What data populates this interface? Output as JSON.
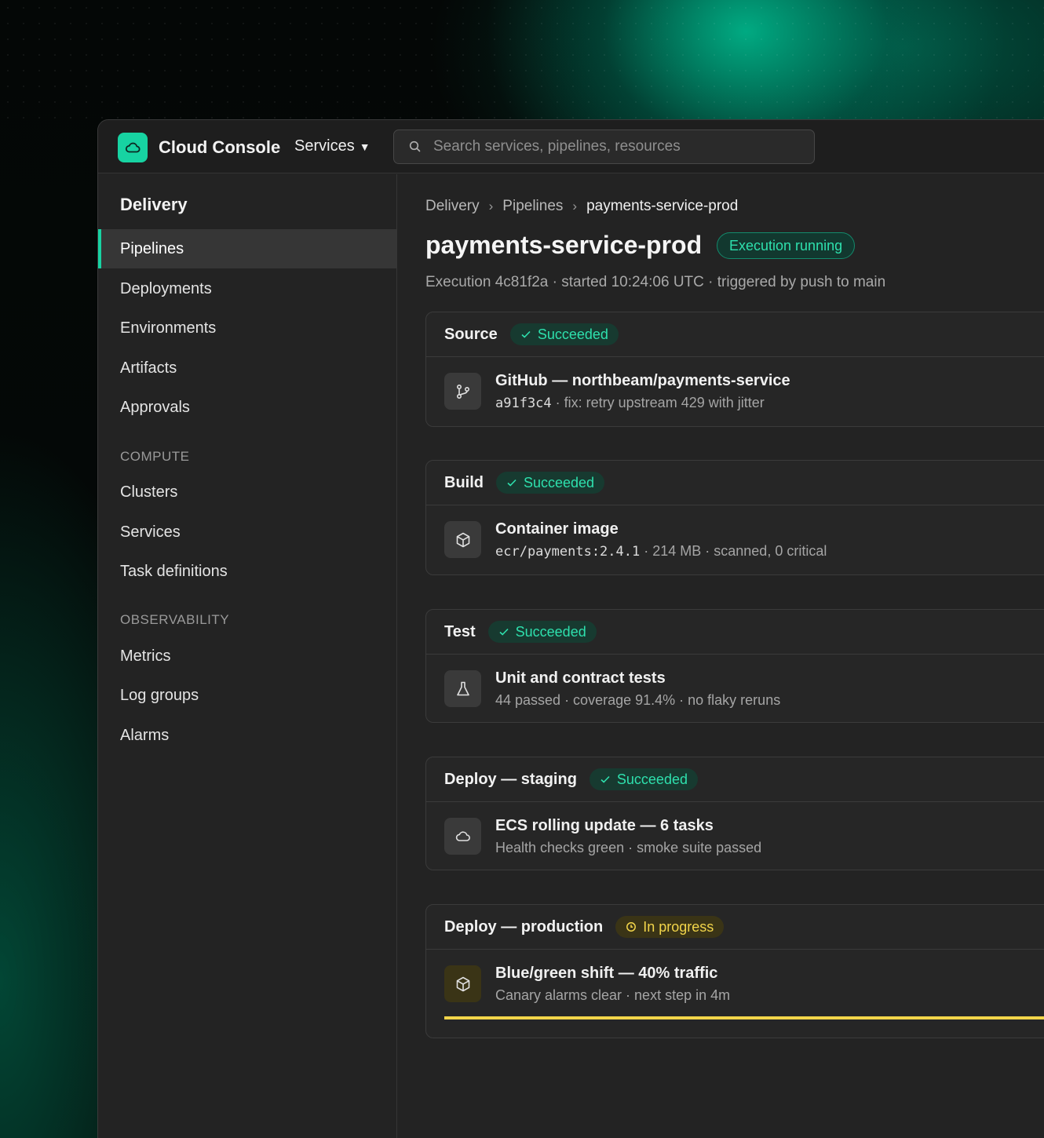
{
  "topbar": {
    "brand": "Cloud Console",
    "services_label": "Services",
    "search_placeholder": "Search services, pipelines, resources"
  },
  "sidebar": {
    "title": "Delivery",
    "items": [
      {
        "label": "Pipelines",
        "active": true
      },
      {
        "label": "Deployments"
      },
      {
        "label": "Environments"
      },
      {
        "label": "Artifacts"
      },
      {
        "label": "Approvals"
      }
    ],
    "compute_label": "COMPUTE",
    "compute_items": [
      {
        "label": "Clusters"
      },
      {
        "label": "Services"
      },
      {
        "label": "Task definitions"
      }
    ],
    "observability_label": "OBSERVABILITY",
    "observability_items": [
      {
        "label": "Metrics"
      },
      {
        "label": "Log groups"
      },
      {
        "label": "Alarms"
      }
    ]
  },
  "main": {
    "breadcrumb": [
      "Delivery",
      "Pipelines",
      "payments-service-prod"
    ],
    "title": "payments-service-prod",
    "status_badge": "Execution running",
    "meta": "Execution 4c81f2a · started 10:24:06 UTC · triggered by push to main",
    "stages": [
      {
        "name": "Source",
        "status": "Succeeded",
        "status_kind": "ok",
        "icon": "git-branch-icon",
        "title": "GitHub — northbeam/payments-service",
        "mono": "a91f3c4",
        "sub": " · fix: retry upstream 429 with jitter"
      },
      {
        "name": "Build",
        "status": "Succeeded",
        "status_kind": "ok",
        "icon": "package-icon",
        "title": "Container image",
        "mono": "ecr/payments:2.4.1",
        "sub": " · 214 MB · scanned, 0 critical"
      },
      {
        "name": "Test",
        "status": "Succeeded",
        "status_kind": "ok",
        "icon": "flask-icon",
        "title": "Unit and contract tests",
        "mono": "",
        "sub": "44 passed · coverage 91.4% · no flaky reruns"
      },
      {
        "name": "Deploy — staging",
        "status": "Succeeded",
        "status_kind": "ok",
        "icon": "cloud-icon",
        "title": "ECS rolling update — 6 tasks",
        "mono": "",
        "sub": "Health checks green · smoke suite passed"
      },
      {
        "name": "Deploy — production",
        "status": "In progress",
        "status_kind": "progress",
        "icon": "package-icon",
        "title": "Blue/green shift — 40% traffic",
        "mono": "",
        "sub": "Canary alarms clear · next step in 4m",
        "progress_percent": 40
      }
    ]
  },
  "colors": {
    "accent": "#17d3a2",
    "success_text": "#2ee0ad",
    "progress_text": "#f2d54a"
  }
}
